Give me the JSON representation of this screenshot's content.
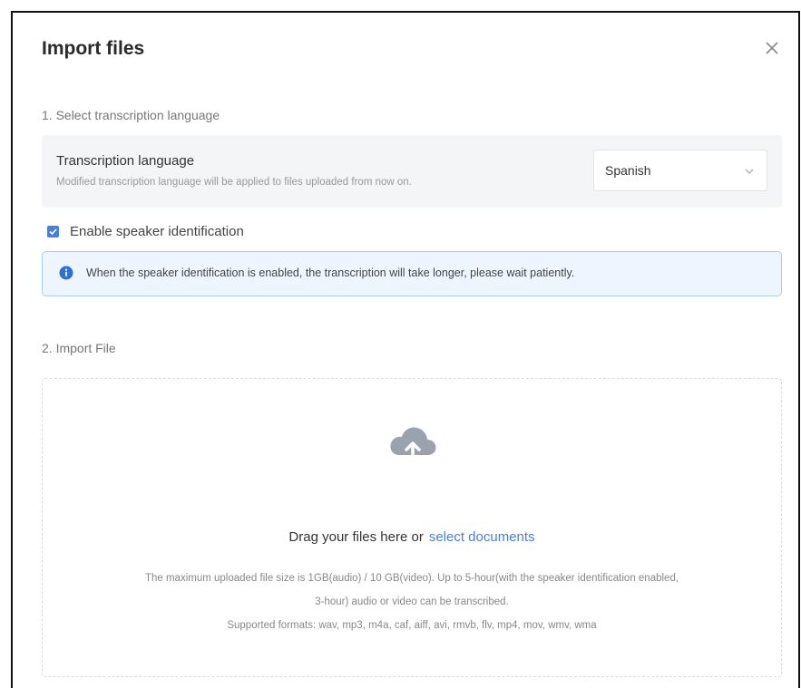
{
  "dialog": {
    "title": "Import files",
    "close_icon": "close-icon"
  },
  "section1": {
    "label": "1. Select transcription language",
    "language_title": "Transcription language",
    "language_desc": "Modified transcription language will be applied to files uploaded from now on.",
    "language_value": "Spanish"
  },
  "speaker": {
    "checkbox_label": "Enable speaker identification",
    "checked": true,
    "info_text": "When the speaker identification is enabled, the transcription will take longer, please wait patiently."
  },
  "section2": {
    "label": "2. Import File",
    "drag_text": "Drag your files here or",
    "select_link": "select documents",
    "hint_line1": "The maximum uploaded file size is 1GB(audio) / 10 GB(video). Up to 5-hour(with the speaker identification enabled,",
    "hint_line2": "3-hour) audio or video can be transcribed.",
    "hint_line3": "Supported formats: wav, mp3, m4a, caf, aiff, avi, rmvb, flv, mp4, mov, wmv, wma"
  },
  "colors": {
    "accent": "#4a7fd6",
    "info_bg": "#eef5ff",
    "info_border": "#a9ccf5"
  }
}
